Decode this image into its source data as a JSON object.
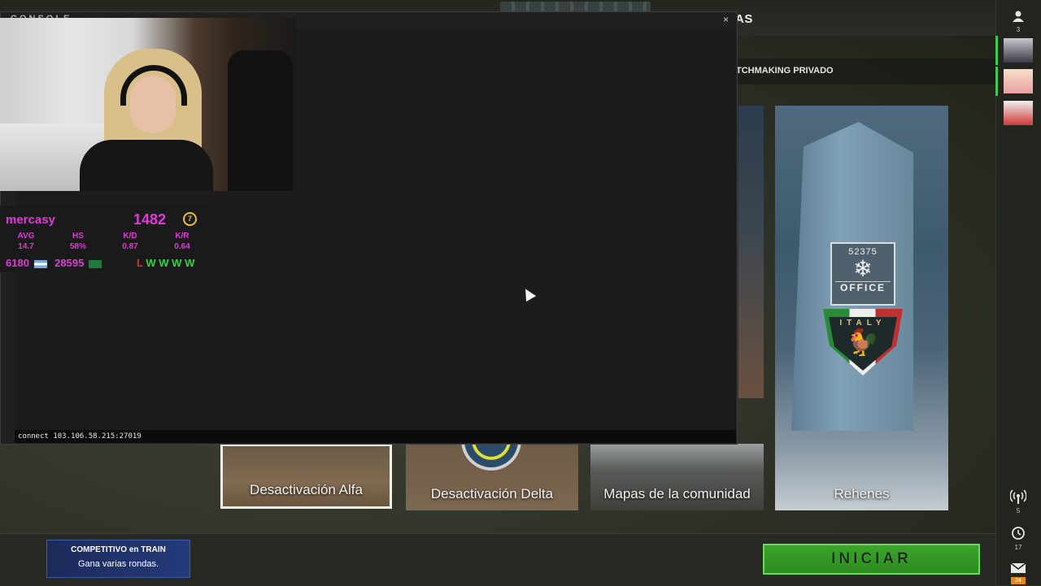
{
  "game": {
    "mode_header_fragment": "AS",
    "subnav_label": "TCHMAKING PRIVADO",
    "mode_cards": [
      {
        "label": "Desactivación Alfa"
      },
      {
        "label": "Desactivación Delta"
      },
      {
        "label": "Mapas de la comunidad"
      },
      {
        "label": "Rehenes"
      }
    ],
    "office_sticker": {
      "number": "52375",
      "text": "OFFICE"
    },
    "italy_badge": {
      "text": "ITALY"
    },
    "promo": {
      "title": "COMPETITIVO en TRAIN",
      "subtitle": "Gana varias rondas."
    },
    "start_button": "INICIAR"
  },
  "sidebar": {
    "friends_count": "3",
    "streams_count": "5",
    "history_count": "17",
    "mail_count": "24"
  },
  "console": {
    "title": "CONSOLE",
    "close_glyph": "×",
    "input_value": "connect 103.106.58.215:27019"
  },
  "stats": {
    "player_name": "mercasy",
    "elo": "1482",
    "level": "7",
    "headers": [
      "AVG",
      "HS",
      "K/D",
      "K/R"
    ],
    "values": [
      "14.7",
      "58%",
      "0.87",
      "0.64"
    ],
    "rank_ar": "6180",
    "rank_region": "28595",
    "results": [
      "L",
      "W",
      "W",
      "W",
      "W"
    ]
  },
  "colors": {
    "accent_magenta": "#e03ad8",
    "win_green": "#2fd83a",
    "loss_red": "#e03030",
    "start_green": "#3aa52a"
  }
}
